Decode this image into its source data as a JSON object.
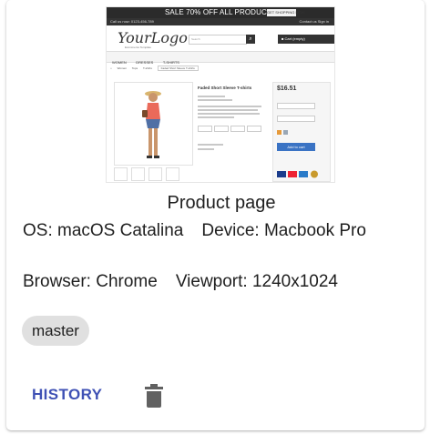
{
  "screenshot": {
    "banner_text": "SALE 70% OFF ALL PRODUCTS",
    "banner_button": "GET SHOPPING NOW",
    "phone": "Call us now: 0123-456-789",
    "header_links": "Contact us  Sign in",
    "logo": "YourLogo",
    "logo_sub": "Ecommerce Template",
    "search_placeholder": "Search",
    "cart": "Cart (empty)",
    "nav": [
      "WOMEN",
      "DRESSES",
      "T-SHIRTS"
    ],
    "breadcrumb": [
      "Women",
      "Tops",
      "T-shirts",
      "Faded Short Sleeve T-shirts"
    ],
    "product_title": "Faded Short Sleeve T-shirts",
    "price": "$16.51",
    "add_to_cart": "Add to cart"
  },
  "card": {
    "title": "Product page",
    "os_label": "OS: macOS Catalina",
    "device_label": "Device: Macbook Pro",
    "browser_label": "Browser: Chrome",
    "viewport_label": "Viewport: 1240x1024",
    "branch": "master",
    "history_label": "HISTORY"
  },
  "icons": {
    "delete": "trash-icon",
    "search": "search-icon",
    "cart": "cart-icon"
  },
  "colors": {
    "accent": "#3f51b5",
    "chip_bg": "#e0e0e0",
    "icon_gray": "#616161"
  }
}
